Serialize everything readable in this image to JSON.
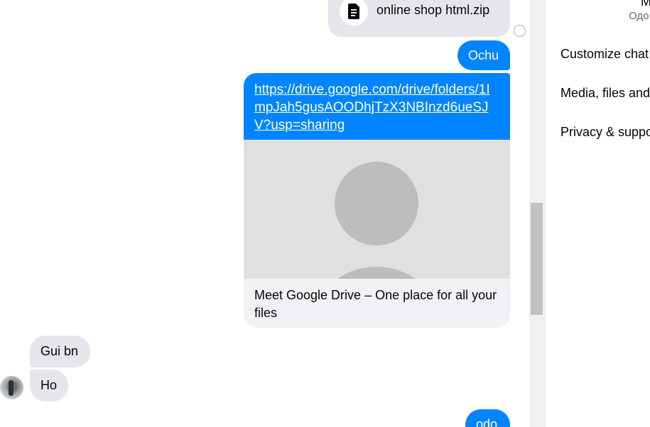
{
  "chat": {
    "file_message": {
      "file_name": "online shop html.zip",
      "icon": "document-icon"
    },
    "outgoing_1": "Ochu",
    "link_message": {
      "url_text": "https://drive.google.com/drive/folders/1ImpJah5gusAOODhjTzX3NBInzd6ueSJV?usp=sharing",
      "preview_title": "Meet Google Drive – One place for all your files",
      "preview_image": "default-avatar-placeholder"
    },
    "incoming_1": "Gui bn",
    "incoming_2": "Ho",
    "outgoing_2": "odo"
  },
  "info_panel": {
    "name": "M",
    "status": "Одо",
    "items": [
      {
        "label": "Customize chat"
      },
      {
        "label": "Media, files and links"
      },
      {
        "label": "Privacy & support"
      }
    ]
  },
  "colors": {
    "outgoing_bubble": "#0084ff",
    "incoming_bubble": "#e4e6eb",
    "panel_background": "#ffffff"
  }
}
